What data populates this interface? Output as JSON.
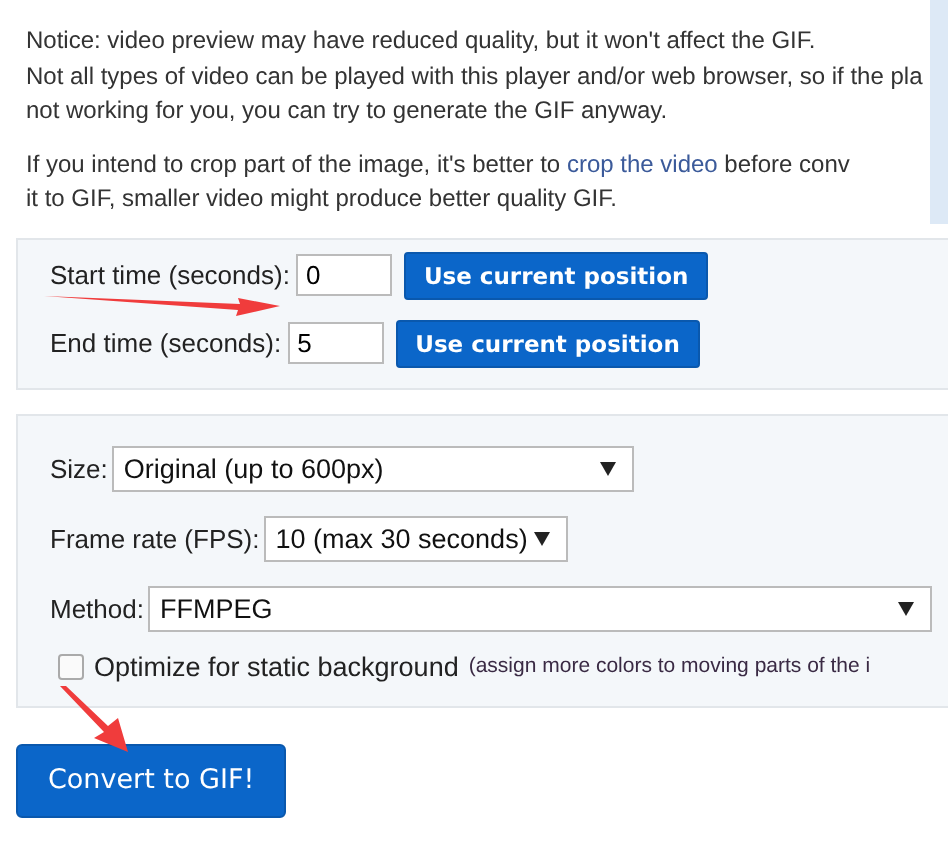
{
  "notice_lines": [
    "Notice: video preview may have reduced quality, but it won't affect the GIF.",
    "Not all types of video can be played with this player and/or web browser, so if the pla",
    "not working for you, you can try to generate the GIF anyway."
  ],
  "crop_tip": {
    "before": "If you intend to crop part of the image, it's better to ",
    "link": "crop the video",
    "after": " before conv",
    "line_2": "it to GIF, smaller video might produce better quality GIF."
  },
  "time_fields": [
    {
      "label": "Start time (seconds):",
      "value": "0",
      "button": "Use current position"
    },
    {
      "label": "End time (seconds):",
      "value": "5",
      "button": "Use current position"
    }
  ],
  "options": [
    {
      "label": "Size:",
      "value": "Original (up to 600px)"
    },
    {
      "label": "Frame rate (FPS):",
      "value": "10 (max 30 seconds)"
    },
    {
      "label": "Method:",
      "value": "FFMPEG"
    }
  ],
  "optimize": {
    "label": "Optimize for static background",
    "note": "(assign more colors to moving parts of the i",
    "checked": false
  },
  "submit": "Convert to GIF!"
}
